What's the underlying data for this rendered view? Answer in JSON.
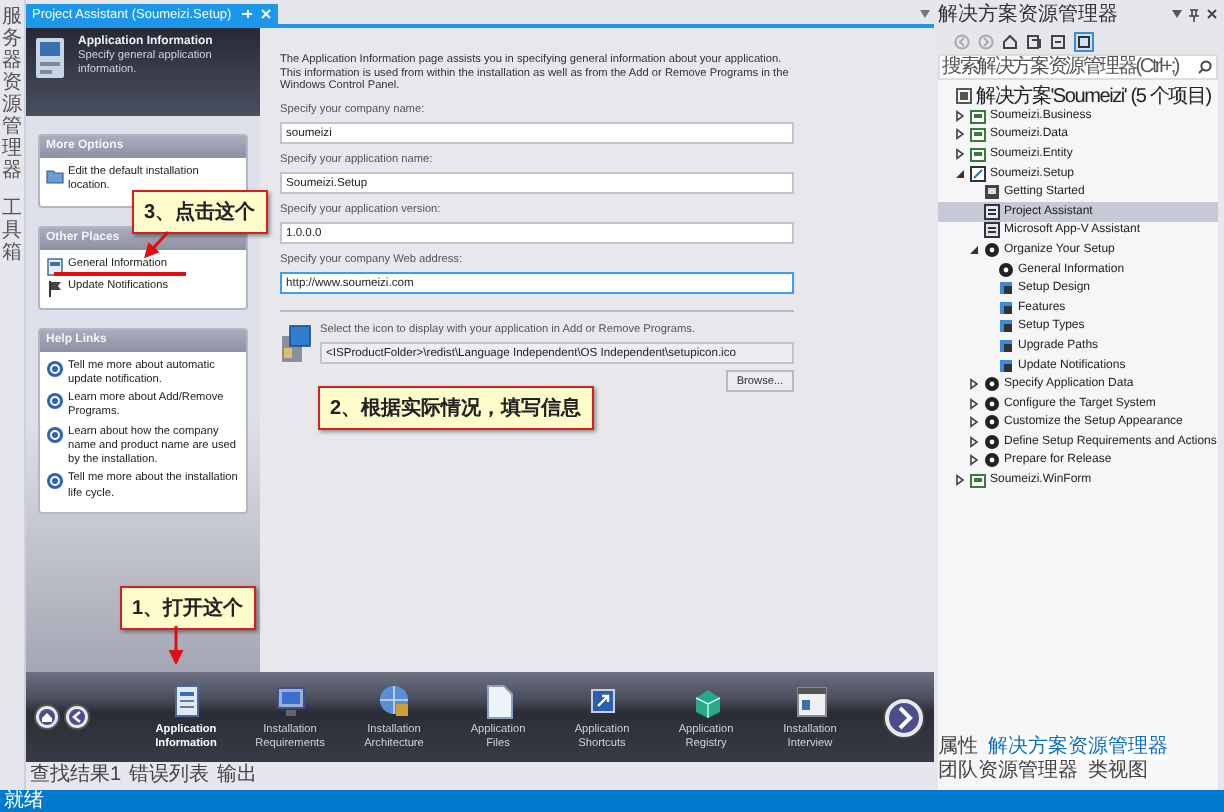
{
  "left_strip": {
    "tabs": [
      "服务器资源管理器",
      "工具箱"
    ]
  },
  "document_tab": {
    "title": "Project Assistant (Soumeizi.Setup)",
    "selected": true
  },
  "banner": {
    "title": "Application Information",
    "subtitle": "Specify general application information."
  },
  "side_panels": [
    {
      "title": "More Options",
      "items": [
        {
          "kind": "folder",
          "label": "Edit the default installation location."
        }
      ]
    },
    {
      "title": "Other Places",
      "items": [
        {
          "kind": "page",
          "label": "General Information"
        },
        {
          "kind": "flag",
          "label": "Update Notifications"
        }
      ]
    },
    {
      "title": "Help Links",
      "items": [
        {
          "kind": "help",
          "label": "Tell me more about automatic update notification."
        },
        {
          "kind": "help",
          "label": "Learn more about Add/Remove Programs."
        },
        {
          "kind": "help",
          "label": "Learn about how the company name and product name are used by the installation."
        },
        {
          "kind": "help",
          "label": "Tell me more about the installation life cycle."
        }
      ]
    }
  ],
  "intro": "The Application Information page assists you in specifying general information about your application. This information is used from within the installation as well as from the Add or Remove Programs in the Windows Control Panel.",
  "fields": [
    {
      "label": "Specify your company name:",
      "value": "soumeizi",
      "focused": false
    },
    {
      "label": "Specify your application name:",
      "value": "Soumeizi.Setup",
      "focused": false
    },
    {
      "label": "Specify your application version:",
      "value": "1.0.0.0",
      "focused": false
    },
    {
      "label": "Specify your company Web address:",
      "value": "http://www.soumeizi.com",
      "focused": true
    }
  ],
  "icon_picker": {
    "label": "Select the icon to display with your application in Add or Remove Programs.",
    "path": "<ISProductFolder>\\redist\\Language Independent\\OS Independent\\setupicon.ico",
    "button": "Browse..."
  },
  "nav_bar": {
    "items": [
      {
        "kind": "info",
        "label": "Application\nInformation",
        "selected": true
      },
      {
        "kind": "requirements",
        "label": "Installation\nRequirements",
        "selected": false
      },
      {
        "kind": "architecture",
        "label": "Installation\nArchitecture",
        "selected": false
      },
      {
        "kind": "files",
        "label": "Application\nFiles",
        "selected": false
      },
      {
        "kind": "shortcuts",
        "label": "Application\nShortcuts",
        "selected": false
      },
      {
        "kind": "registry",
        "label": "Application\nRegistry",
        "selected": false
      },
      {
        "kind": "interview",
        "label": "Installation\nInterview",
        "selected": false
      }
    ]
  },
  "output_tabs": [
    {
      "label": "查找结果1",
      "selected": false
    },
    {
      "label": "错误列表",
      "selected": false
    },
    {
      "label": "输出",
      "selected": false
    }
  ],
  "solution_explorer": {
    "title": "解决方案资源管理器",
    "search": {
      "placeholder": "搜索解决方案资源管理器(Ctrl+;)"
    },
    "tree": [
      {
        "kind": "solution",
        "label": "解决方案'Soumeizi' (5 个项目)",
        "selected": false,
        "children": [
          {
            "kind": "project",
            "label": "Soumeizi.Business",
            "expanded": false,
            "selected": false
          },
          {
            "kind": "project",
            "label": "Soumeizi.Data",
            "expanded": false,
            "selected": false
          },
          {
            "kind": "project",
            "label": "Soumeizi.Entity",
            "expanded": false,
            "selected": false
          },
          {
            "kind": "setup",
            "label": "Soumeizi.Setup",
            "expanded": true,
            "selected": false,
            "children": [
              {
                "kind": "page",
                "label": "Getting Started",
                "selected": false
              },
              {
                "kind": "assistant",
                "label": "Project Assistant",
                "selected": true
              },
              {
                "kind": "assistant",
                "label": "Microsoft App-V Assistant",
                "selected": false
              },
              {
                "kind": "step",
                "label": "Organize Your Setup",
                "expanded": true,
                "selected": false,
                "children": [
                  {
                    "kind": "step",
                    "label": "General Information",
                    "selected": false
                  },
                  {
                    "kind": "item",
                    "label": "Setup Design",
                    "selected": false
                  },
                  {
                    "kind": "item",
                    "label": "Features",
                    "selected": false
                  },
                  {
                    "kind": "item",
                    "label": "Setup Types",
                    "selected": false
                  },
                  {
                    "kind": "item",
                    "label": "Upgrade Paths",
                    "selected": false
                  },
                  {
                    "kind": "item",
                    "label": "Update Notifications",
                    "selected": false
                  }
                ]
              },
              {
                "kind": "step",
                "label": "Specify Application Data",
                "expanded": false,
                "selected": false
              },
              {
                "kind": "step",
                "label": "Configure the Target System",
                "expanded": false,
                "selected": false
              },
              {
                "kind": "step",
                "label": "Customize the Setup Appearance",
                "expanded": false,
                "selected": false
              },
              {
                "kind": "step",
                "label": "Define Setup Requirements and Actions",
                "expanded": false,
                "selected": false
              },
              {
                "kind": "step",
                "label": "Prepare for Release",
                "expanded": false,
                "selected": false
              }
            ]
          },
          {
            "kind": "project",
            "label": "Soumeizi.WinForm",
            "expanded": false,
            "selected": false
          }
        ]
      }
    ],
    "tabs": [
      {
        "label": "属性",
        "selected": false
      },
      {
        "label": "解决方案资源管理器",
        "selected": true
      },
      {
        "label": "团队资源管理器",
        "selected": false
      },
      {
        "label": "类视图",
        "selected": false
      }
    ]
  },
  "status_bar": {
    "text": "就绪"
  },
  "annotations": [
    {
      "kind": "callout",
      "text": "3、点击这个"
    },
    {
      "kind": "callout",
      "text": "2、根据实际情况，填写信息"
    },
    {
      "kind": "callout",
      "text": "1、打开这个"
    }
  ]
}
